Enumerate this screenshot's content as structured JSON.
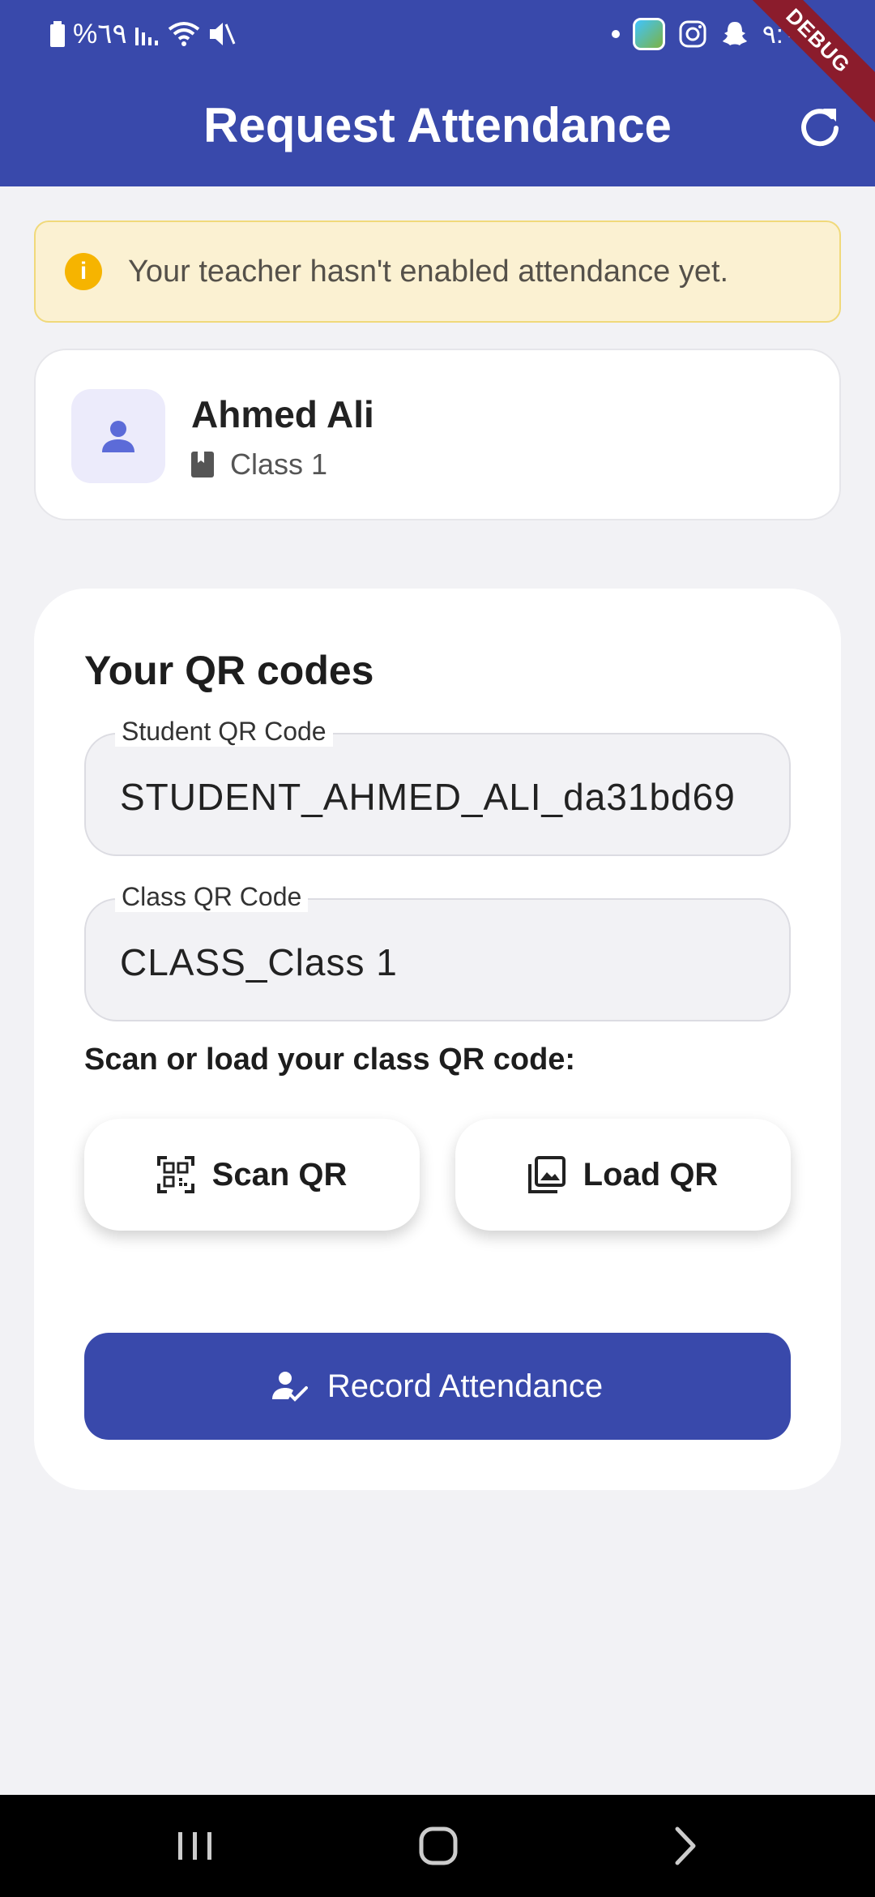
{
  "status_bar": {
    "battery_percent": "%٦٩",
    "time": "٩:٠",
    "icons": [
      "battery-icon",
      "signal-icon",
      "wifi-icon",
      "mute-icon",
      "dot-icon",
      "app-icon",
      "instagram-icon",
      "snapchat-icon"
    ]
  },
  "debug_banner": "DEBUG",
  "appbar": {
    "title": "Request Attendance",
    "refresh_icon": "refresh-icon"
  },
  "notice": {
    "icon": "info-icon",
    "text": "Your teacher hasn't enabled attendance yet."
  },
  "student": {
    "name": "Ahmed Ali",
    "class": "Class 1",
    "avatar_icon": "person-icon",
    "class_icon": "book-icon"
  },
  "qr_section": {
    "heading": "Your QR codes",
    "student_qr": {
      "label": "Student QR Code",
      "value": "STUDENT_AHMED_ALI_da31bd69"
    },
    "class_qr": {
      "label": "Class QR Code",
      "value": "CLASS_Class 1"
    },
    "scan_prompt": "Scan or load your class QR code:",
    "scan_button": "Scan QR",
    "load_button": "Load QR",
    "record_button": "Record Attendance"
  },
  "colors": {
    "primary": "#3949ab",
    "background": "#f2f2f5",
    "notice_bg": "#fbf1d2",
    "notice_icon": "#f6b400",
    "avatar_bg": "#ecebfb",
    "avatar_icon": "#5c6bd8"
  }
}
